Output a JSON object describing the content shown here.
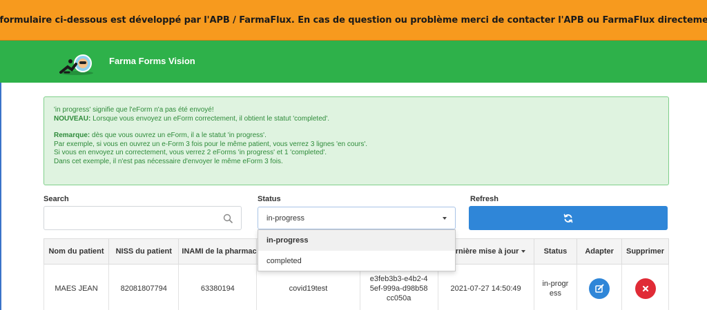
{
  "banner": {
    "text": "Le formulaire ci-dessous est développé par l'APB / FarmaFlux. En cas de question ou problème merci de contacter l'APB ou FarmaFlux directement."
  },
  "navbar": {
    "brand": "Farma Forms Vision"
  },
  "alert": {
    "line1": "'in progress' signifie que l'eForm n'a pas été envoyé!",
    "line2_bold": "NOUVEAU:",
    "line2_rest": " Lorsque vous envoyez un eForm correctement, il obtient le statut 'completed'.",
    "line3_bold": "Remarque:",
    "line3_rest": " dès que vous ouvrez un eForm, il a le statut 'in progress'.",
    "line4": "Par exemple, si vous en ouvrez un e-Form 3 fois pour le même patient, vous verrez 3 lignes 'en cours'.",
    "line5": "Si vous en envoyez un correctement, vous verrez 2 eForms 'in progress' et 1 'completed'.",
    "line6": "Dans cet exemple, il n'est pas nécessaire d'envoyer le même eForm 3 fois."
  },
  "filters": {
    "search_label": "Search",
    "search_value": "",
    "status_label": "Status",
    "status_value": "in-progress",
    "status_options": [
      "in-progress",
      "completed"
    ],
    "refresh_label": "Refresh"
  },
  "table": {
    "headers": {
      "patient_name": "Nom du patient",
      "patient_niss": "NISS du patient",
      "inami": "INAMI de la pharmacie",
      "form": "",
      "id": "",
      "last_update": "Dernière mise à jour",
      "status": "Status",
      "adapt": "Adapter",
      "delete": "Supprimer"
    },
    "rows": [
      {
        "patient_name": "MAES JEAN",
        "patient_niss": "82081807794",
        "inami": "63380194",
        "form": "covid19test",
        "id": "e3feb3b3-e4b2-45ef-999a-d98b58cc050a",
        "last_update": "2021-07-27 14:50:49",
        "status": "in-progress"
      }
    ]
  },
  "colors": {
    "banner": "#f79a1e",
    "navbar": "#2eb14a",
    "primary": "#2f86d8",
    "danger": "#e02b36",
    "alert_bg": "#dff3e0"
  },
  "icons": {
    "search": "search-icon",
    "refresh": "refresh-icon",
    "edit": "edit-icon",
    "delete": "close-icon"
  }
}
